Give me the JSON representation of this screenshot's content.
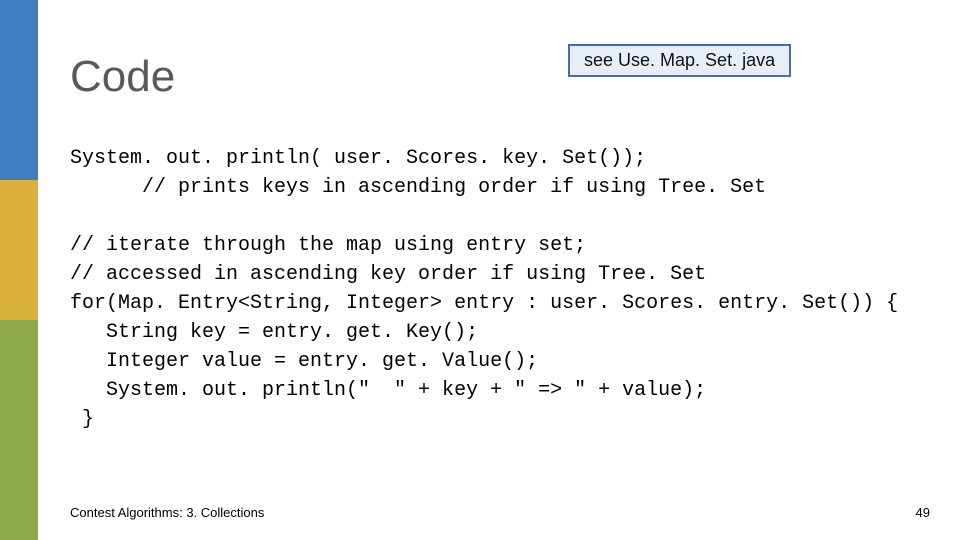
{
  "title": "Code",
  "callout": "see Use. Map. Set. java",
  "code": "System. out. println( user. Scores. key. Set());\n      // prints keys in ascending order if using Tree. Set\n\n// iterate through the map using entry set;\n// accessed in ascending key order if using Tree. Set\nfor(Map. Entry<String, Integer> entry : user. Scores. entry. Set()) {\n   String key = entry. get. Key();\n   Integer value = entry. get. Value();\n   System. out. println(\"  \" + key + \" => \" + value);\n }",
  "footer": {
    "left": "Contest Algorithms: 3. Collections",
    "page": "49"
  }
}
